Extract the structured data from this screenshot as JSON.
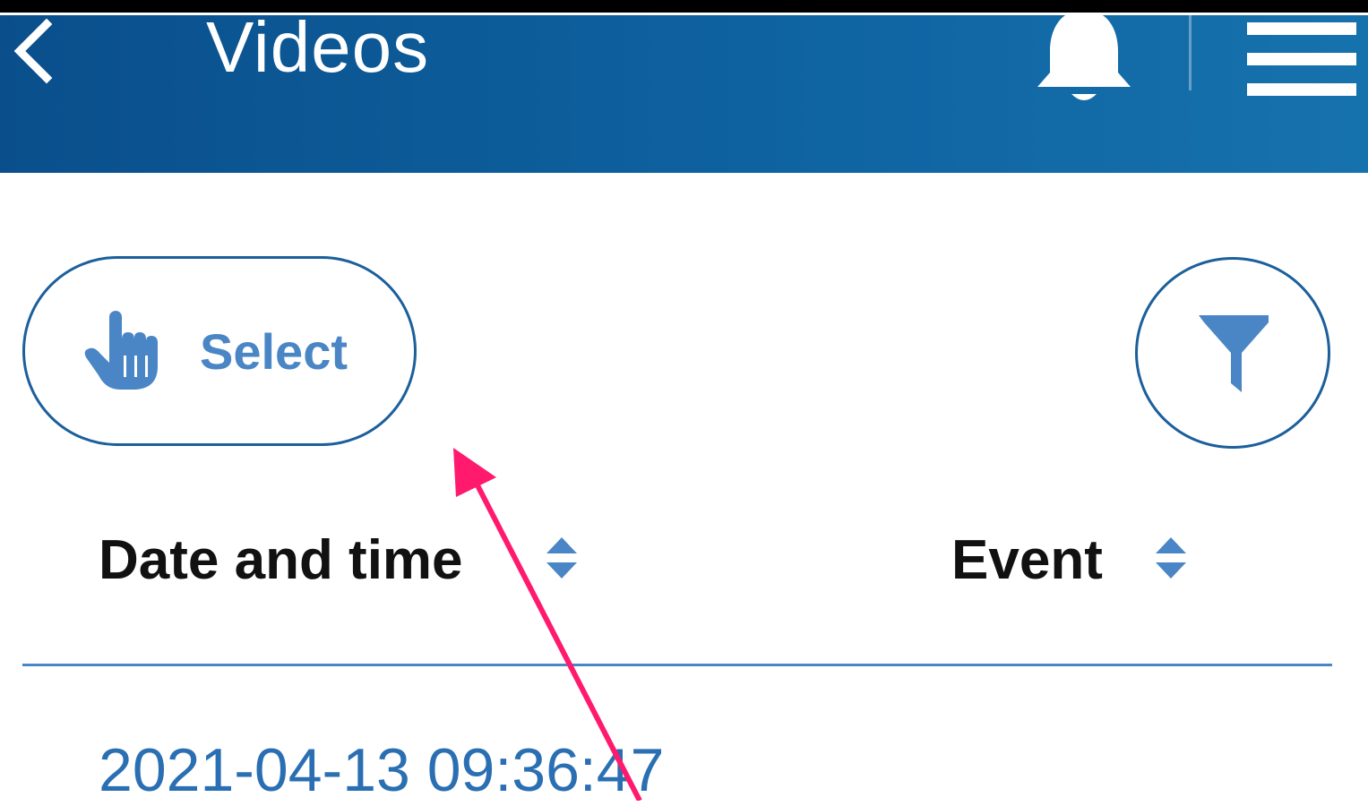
{
  "header": {
    "title": "Videos",
    "background_color": "#0e62a0",
    "icons": {
      "back": "chevron-left-icon",
      "notifications": "bell-icon",
      "menu": "hamburger-menu-icon"
    }
  },
  "toolbar": {
    "select_label": "Select",
    "select_icon": "pointing-hand-icon",
    "filter_icon": "funnel-filter-icon"
  },
  "table": {
    "columns": [
      {
        "label": "Date and time",
        "sort_icon": "sort-up-down-icon"
      },
      {
        "label": "Event",
        "sort_icon": "sort-up-down-icon"
      }
    ],
    "rows": [
      {
        "date_time": "2021-04-13 09:36:47"
      }
    ]
  },
  "colors": {
    "accent": "#4a86c5",
    "border": "#1b5f9b",
    "annotation_arrow": "#ff1a6e"
  }
}
